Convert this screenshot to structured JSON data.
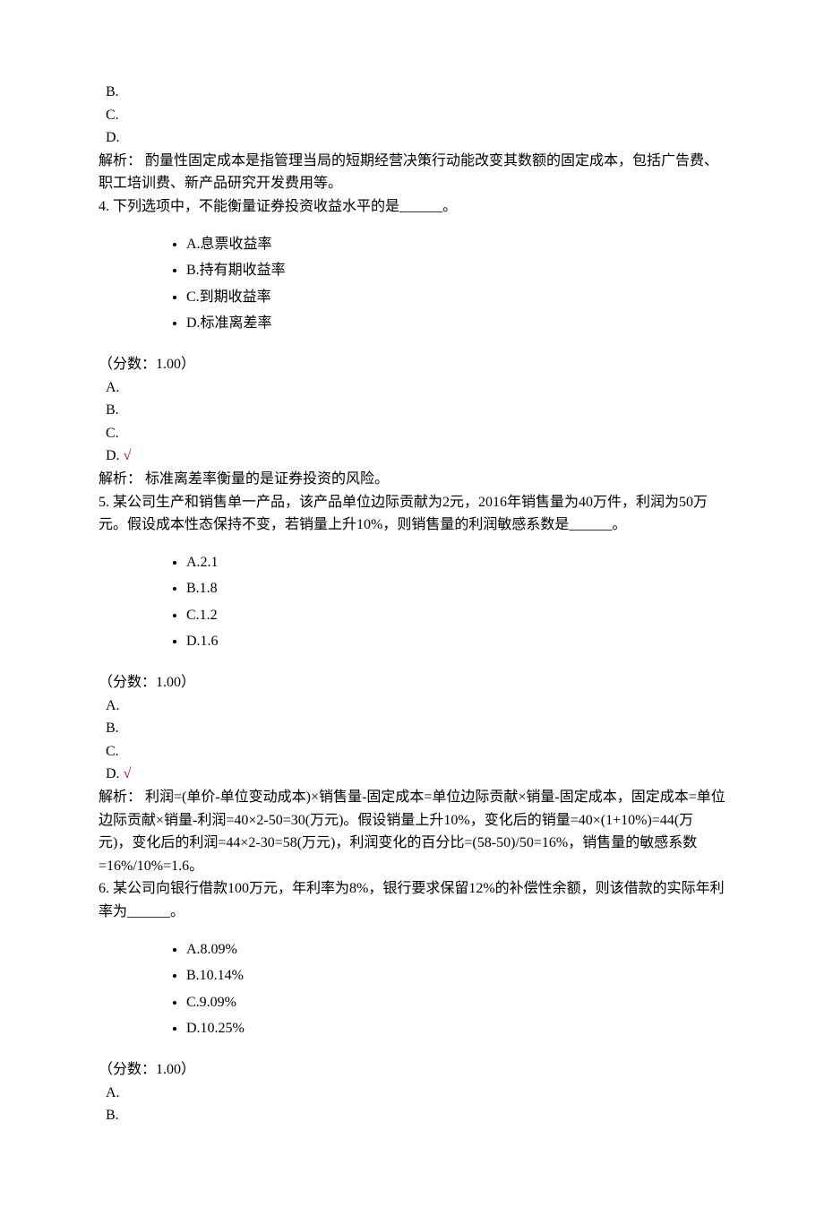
{
  "q3_trail": {
    "ans_b": "B.",
    "ans_c": "C.",
    "ans_d": "D.",
    "explain": "解析： 酌量性固定成本是指管理当局的短期经营决策行动能改变其数额的固定成本，包括广告费、职工培训费、新产品研究开发费用等。"
  },
  "q4": {
    "stem": "4. 下列选项中，不能衡量证券投资收益水平的是______。",
    "opts": {
      "a": "A.息票收益率",
      "b": "B.持有期收益率",
      "c": "C.到期收益率",
      "d": "D.标准离差率"
    },
    "score": "（分数：1.00）",
    "ans_a": "A.",
    "ans_b": "B.",
    "ans_c": "C.",
    "ans_d": "D.",
    "check": "√",
    "explain": "解析： 标准离差率衡量的是证券投资的风险。"
  },
  "q5": {
    "stem": "5. 某公司生产和销售单一产品，该产品单位边际贡献为2元，2016年销售量为40万件，利润为50万元。假设成本性态保持不变，若销量上升10%，则销售量的利润敏感系数是______。",
    "opts": {
      "a": "A.2.1",
      "b": "B.1.8",
      "c": "C.1.2",
      "d": "D.1.6"
    },
    "score": "（分数：1.00）",
    "ans_a": "A.",
    "ans_b": "B.",
    "ans_c": "C.",
    "ans_d": "D.",
    "check": "√",
    "explain": "解析： 利润=(单价-单位变动成本)×销售量-固定成本=单位边际贡献×销量-固定成本，固定成本=单位边际贡献×销量-利润=40×2-50=30(万元)。假设销量上升10%，变化后的销量=40×(1+10%)=44(万元)，变化后的利润=44×2-30=58(万元)，利润变化的百分比=(58-50)/50=16%，销售量的敏感系数=16%/10%=1.6。"
  },
  "q6": {
    "stem": "6. 某公司向银行借款100万元，年利率为8%，银行要求保留12%的补偿性余额，则该借款的实际年利率为______。",
    "opts": {
      "a": "A.8.09%",
      "b": "B.10.14%",
      "c": "C.9.09%",
      "d": "D.10.25%"
    },
    "score": "（分数：1.00）",
    "ans_a": "A.",
    "ans_b": "B."
  }
}
